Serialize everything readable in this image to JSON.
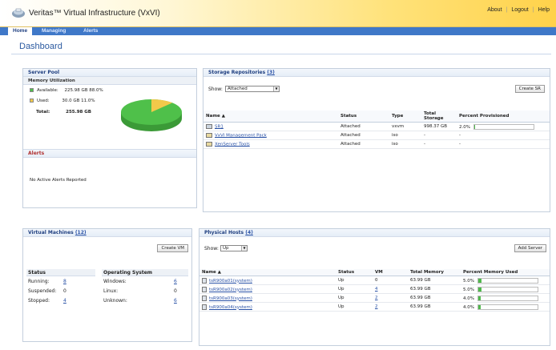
{
  "app": {
    "title": "Veritas™ Virtual Infrastructure (VxVI)"
  },
  "top_links": [
    "About",
    "Logout",
    "Help"
  ],
  "nav": {
    "tabs": [
      "Home",
      "Managing",
      "Alerts"
    ]
  },
  "page": {
    "title": "Dashboard"
  },
  "server_pool": {
    "title": "Server Pool",
    "memory_heading": "Memory Utilization",
    "available_label": "Available:",
    "available_value": "225.98 GB 88.0%",
    "used_label": "Used:",
    "used_value": "30.0 GB 11.0%",
    "total_label": "Total:",
    "total_value": "255.98 GB",
    "available_fraction": 0.88,
    "colors": {
      "available": "#4fc04a",
      "used": "#f2c94a"
    }
  },
  "alerts": {
    "title": "Alerts",
    "message": "No Active Alerts Reported"
  },
  "storage": {
    "title": "Storage Repositories",
    "count": "(3)",
    "show_label": "Show:",
    "show_value": "Attached",
    "create_button": "Create SR",
    "columns": [
      "Name ▲",
      "Status",
      "Type",
      "Total Storage",
      "Percent Provisioned"
    ],
    "rows": [
      {
        "name": "SR1",
        "status": "Attached",
        "type": "vxvm",
        "total": "998.37 GB",
        "percent": "2.0%",
        "fraction": 0.02
      },
      {
        "name": "VxVI Management Pack",
        "status": "Attached",
        "type": "iso",
        "total": "-",
        "percent": "-",
        "fraction": 0
      },
      {
        "name": "XenServer Tools",
        "status": "Attached",
        "type": "iso",
        "total": "-",
        "percent": "-",
        "fraction": 0
      }
    ]
  },
  "vms": {
    "title": "Virtual Machines",
    "count": "(12)",
    "create_button": "Create VM",
    "status_heading": "Status",
    "os_heading": "Operating System",
    "status_rows": [
      {
        "label": "Running:",
        "value": "8"
      },
      {
        "label": "Suspended:",
        "value": "0"
      },
      {
        "label": "Stopped:",
        "value": "4"
      }
    ],
    "os_rows": [
      {
        "label": "Windows:",
        "value": "6"
      },
      {
        "label": "Linux:",
        "value": "0"
      },
      {
        "label": "Unknown:",
        "value": "6"
      }
    ]
  },
  "hosts": {
    "title": "Physical Hosts",
    "count": "(4)",
    "show_label": "Show:",
    "show_value": "Up",
    "add_button": "Add Server",
    "columns": [
      "Name ▲",
      "Status",
      "VM",
      "Total Memory",
      "Percent Memory Used"
    ],
    "rows": [
      {
        "name": "tsR900a01(system)",
        "status": "Up",
        "vm": "0",
        "memory": "63.99 GB",
        "percent": "5.0%",
        "fraction": 0.05
      },
      {
        "name": "tsR900a02(system)",
        "status": "Up",
        "vm": "4",
        "memory": "63.99 GB",
        "percent": "5.0%",
        "fraction": 0.05
      },
      {
        "name": "tsR900a03(system)",
        "status": "Up",
        "vm": "2",
        "memory": "63.99 GB",
        "percent": "4.0%",
        "fraction": 0.04
      },
      {
        "name": "tsR900a04(system)",
        "status": "Up",
        "vm": "2",
        "memory": "63.99 GB",
        "percent": "4.0%",
        "fraction": 0.04
      }
    ]
  }
}
